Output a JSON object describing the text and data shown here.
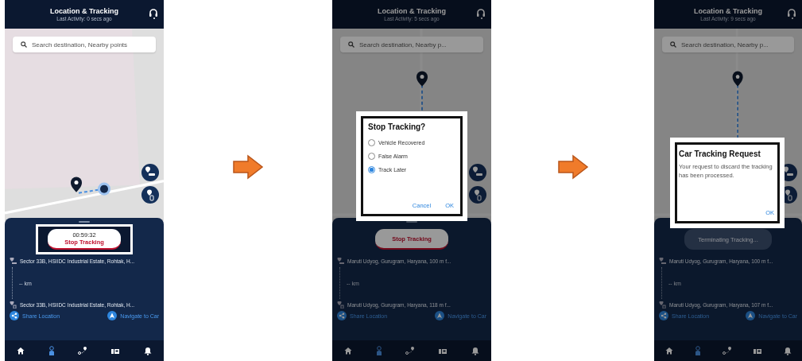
{
  "screens": [
    {
      "dimmed": false,
      "header": {
        "title": "Location & Tracking",
        "subtitle": "Last Activity: 0 secs ago"
      },
      "search": {
        "placeholder": "Search destination, Nearby points"
      },
      "map": {
        "kind": "horizontal"
      },
      "status": {
        "kind": "timer",
        "time": "00:59:32",
        "label": "Stop Tracking",
        "highlighted": true
      },
      "trip": {
        "origin": "Sector 33B, HSIIDC Industrial Estate, Rohtak, H...",
        "distance": "-- km",
        "destination": "Sector 33B, HSIIDC Industrial Estate, Rohtak, H..."
      },
      "actions": [
        "Share Location",
        "Navigate to Car"
      ],
      "nav": [
        {
          "kind": "home",
          "selected": false
        },
        {
          "kind": "person",
          "selected": true
        },
        {
          "kind": "route",
          "selected": false
        },
        {
          "kind": "car",
          "selected": false
        },
        {
          "kind": "bell",
          "selected": false
        }
      ]
    },
    {
      "dimmed": true,
      "header": {
        "title": "Location & Tracking",
        "subtitle": "Last Activity: 5 secs ago"
      },
      "search": {
        "placeholder": "Search destination, Nearby p..."
      },
      "map": {
        "kind": "vertical"
      },
      "status": {
        "kind": "timer",
        "label": "Stop Tracking",
        "highlighted": false
      },
      "trip": {
        "origin": "Maruti Udyog, Gurugram, Haryana, 100 m f...",
        "distance": "-- km",
        "destination": "Maruti Udyog, Gurugram, Haryana, 118 m f..."
      },
      "actions": [
        "Share Location",
        "Navigate to Car"
      ],
      "nav": [
        {
          "kind": "home",
          "selected": false
        },
        {
          "kind": "person",
          "selected": true
        },
        {
          "kind": "route",
          "selected": false
        },
        {
          "kind": "car",
          "selected": false
        },
        {
          "kind": "bell",
          "selected": false
        }
      ],
      "dialog": {
        "kind": "choice",
        "title": "Stop Tracking?",
        "highlighted": true,
        "options": [
          {
            "label": "Vehicle Recovered",
            "selected": false
          },
          {
            "label": "False Alarm",
            "selected": false
          },
          {
            "label": "Track Later",
            "selected": true
          }
        ],
        "buttons": [
          "Cancel",
          "OK"
        ]
      }
    },
    {
      "dimmed": true,
      "header": {
        "title": "Location & Tracking",
        "subtitle": "Last Activity: 9 secs ago"
      },
      "search": {
        "placeholder": "Search destination, Nearby p..."
      },
      "map": {
        "kind": "vertical"
      },
      "status": {
        "kind": "pending",
        "label": "Terminating Tracking...",
        "highlighted": false
      },
      "trip": {
        "origin": "Maruti Udyog, Gurugram, Haryana, 100 m f...",
        "distance": "-- km",
        "destination": "Maruti Udyog, Gurugram, Haryana, 107 m f..."
      },
      "actions": [
        "Share Location",
        "Navigate to Car"
      ],
      "nav": [
        {
          "kind": "home",
          "selected": false
        },
        {
          "kind": "person",
          "selected": true
        },
        {
          "kind": "route",
          "selected": false
        },
        {
          "kind": "car",
          "selected": false
        },
        {
          "kind": "bell",
          "selected": false
        }
      ],
      "dialog": {
        "kind": "message",
        "title": "Car Tracking Request",
        "highlighted": true,
        "body": "Your request to discard the tracking has been processed.",
        "buttons": [
          "OK"
        ]
      }
    }
  ]
}
